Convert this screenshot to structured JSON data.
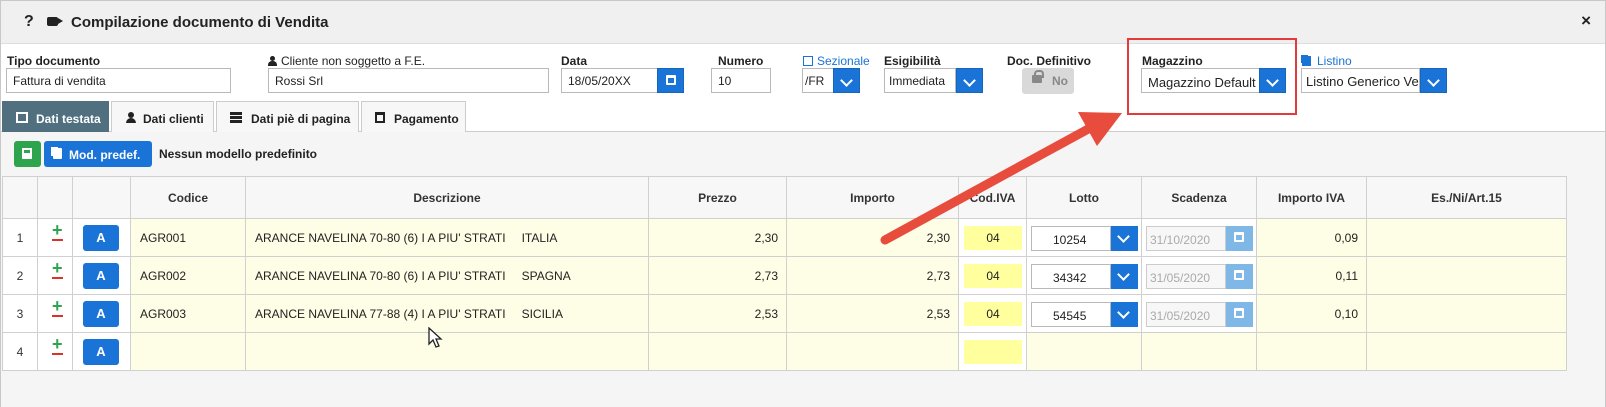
{
  "window": {
    "help_glyph": "?",
    "title": "Compilazione documento di Vendita",
    "close_glyph": "×",
    "icons": [
      "help-icon",
      "video-camera-icon",
      "close-icon"
    ]
  },
  "header": {
    "tipo_documento": {
      "label": "Tipo documento",
      "value": "Fattura di vendita"
    },
    "cliente": {
      "label": "Cliente non soggetto a F.E.",
      "value": "Rossi Srl",
      "icon": "user-icon"
    },
    "data": {
      "label": "Data",
      "value": "18/05/20",
      "mask": "XX",
      "icon": "calendar-icon"
    },
    "numero": {
      "label": "Numero",
      "value": "10"
    },
    "sezionale": {
      "label": "Sezionale",
      "value": "/FR",
      "icon": "edit-icon"
    },
    "esigibilita": {
      "label": "Esigibilità",
      "value": "Immediata"
    },
    "doc_definitivo": {
      "label": "Doc. Definitivo",
      "value": "No",
      "icon": "lock-icon"
    },
    "magazzino": {
      "label": "Magazzino",
      "value": "Magazzino Default"
    },
    "listino": {
      "label": "Listino",
      "value": "Listino Generico Ver",
      "icon": "copy-icon"
    }
  },
  "tabs": [
    {
      "label": "Dati testata",
      "icon": "table-icon",
      "active": true
    },
    {
      "label": "Dati clienti",
      "icon": "user-icon",
      "active": false
    },
    {
      "label": "Dati piè di pagina",
      "icon": "list-icon",
      "active": false
    },
    {
      "label": "Pagamento",
      "icon": "calendar-icon",
      "active": false
    }
  ],
  "toolbar": {
    "save_icon": "save-icon",
    "mod_predef_label": "Mod. predef.",
    "modello_text": "Nessun modello predefinito"
  },
  "grid": {
    "columns": [
      "",
      "",
      "",
      "Codice",
      "Descrizione",
      "Prezzo",
      "Importo",
      "Cod.IVA",
      "Lotto",
      "Scadenza",
      "Importo IVA",
      "Es./Ni/Art.15"
    ],
    "row_action_label": "A",
    "rows": [
      {
        "n": "1",
        "codice": "AGR001",
        "descrizione": "ARANCE NAVELINA 70-80 (6) I A PIU' STRATI",
        "origine": "ITALIA",
        "prezzo": "2,30",
        "importo": "2,30",
        "iva": "04",
        "lotto": "10254",
        "scadenza": "31/10/2020",
        "importo_iva": "0,09",
        "es": ""
      },
      {
        "n": "2",
        "codice": "AGR002",
        "descrizione": "ARANCE NAVELINA 70-80 (6) I A PIU' STRATI",
        "origine": "SPAGNA",
        "prezzo": "2,73",
        "importo": "2,73",
        "iva": "04",
        "lotto": "34342",
        "scadenza": "31/05/2020",
        "importo_iva": "0,11",
        "es": ""
      },
      {
        "n": "3",
        "codice": "AGR003",
        "descrizione": "ARANCE NAVELINA 77-88 (4) I A PIU' STRATI",
        "origine": "SICILIA",
        "prezzo": "2,53",
        "importo": "2,53",
        "iva": "04",
        "lotto": "54545",
        "scadenza": "31/05/2020",
        "importo_iva": "0,10",
        "es": ""
      },
      {
        "n": "4",
        "codice": "",
        "descrizione": "",
        "origine": "",
        "prezzo": "",
        "importo": "",
        "iva": "",
        "lotto": "",
        "scadenza": "",
        "importo_iva": "",
        "es": ""
      }
    ]
  },
  "annotation": {
    "highlight_color": "#e23b3b",
    "arrow_color": "#e74c3c"
  },
  "colors": {
    "primary": "#1a73d6",
    "success": "#2ea44f",
    "danger": "#d9342b",
    "tab_active": "#51707f",
    "row_bg": "#fefde5",
    "iva_bg": "#ffff9e"
  }
}
